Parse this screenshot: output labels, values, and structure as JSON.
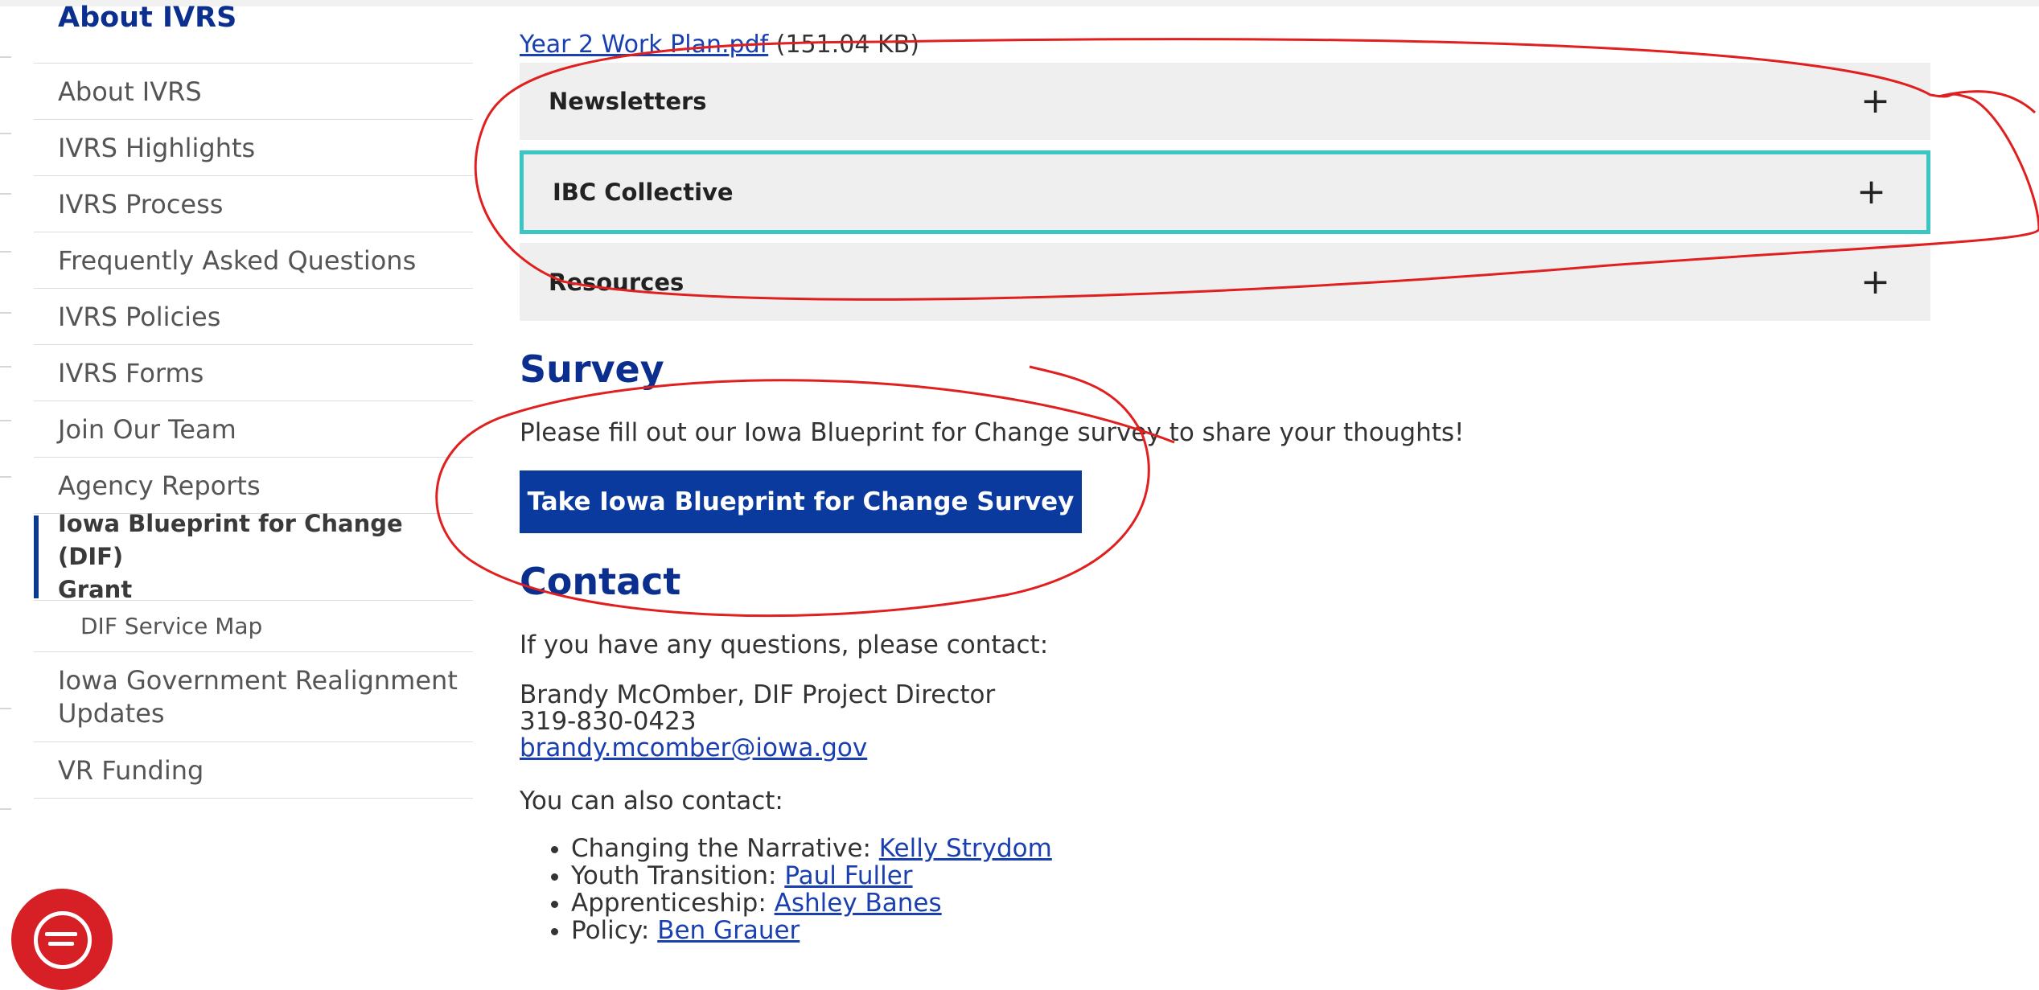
{
  "colors": {
    "brand_blue": "#0b2f8f",
    "button_blue": "#0b3a9e",
    "link_blue": "#1a3fb0",
    "focus_teal": "#3cc6c3",
    "annotation_red": "#e01f1f",
    "chat_red": "#d71f26"
  },
  "sidebar": {
    "title": "About IVRS",
    "items": [
      {
        "label": "About IVRS"
      },
      {
        "label": "IVRS Highlights"
      },
      {
        "label": "IVRS Process"
      },
      {
        "label": "Frequently Asked Questions"
      },
      {
        "label": "IVRS Policies"
      },
      {
        "label": "IVRS Forms"
      },
      {
        "label": "Join Our Team"
      },
      {
        "label": "Agency Reports"
      },
      {
        "label_line1": "Iowa Blueprint for Change (DIF)",
        "label_line2": "Grant",
        "active": true
      },
      {
        "label": "DIF Service Map",
        "sub": true
      },
      {
        "label_line1": "Iowa Government Realignment",
        "label_line2": "Updates"
      },
      {
        "label": "VR Funding"
      }
    ]
  },
  "main": {
    "file_link": "Year 2 Work Plan.pdf",
    "file_size": "(151.04 KB)",
    "accordions": [
      {
        "label": "Newsletters",
        "icon": "plus-icon"
      },
      {
        "label": "IBC Collective",
        "icon": "plus-icon",
        "focused": true
      },
      {
        "label": "Resources",
        "icon": "plus-icon"
      }
    ],
    "survey_heading": "Survey",
    "survey_text": "Please fill out our Iowa Blueprint for Change survey to share your thoughts!",
    "survey_button": "Take Iowa Blueprint for Change Survey",
    "contact_heading": "Contact",
    "contact_intro": "If you have any questions, please contact:",
    "contact_name": "Brandy McOmber, DIF Project Director",
    "contact_phone": "319-830-0423",
    "contact_email": "brandy.mcomber@iowa.gov",
    "also_contact": "You can also contact:",
    "contacts": [
      {
        "role": "Changing the Narrative:",
        "name": "Kelly Strydom"
      },
      {
        "role": "Youth Transition:",
        "name": "Paul Fuller"
      },
      {
        "role": "Apprenticeship:",
        "name": "Ashley Banes"
      },
      {
        "role": "Policy:",
        "name": "Ben Grauer"
      }
    ],
    "plus_glyph": "+"
  },
  "chat": {
    "icon": "chat-icon"
  }
}
